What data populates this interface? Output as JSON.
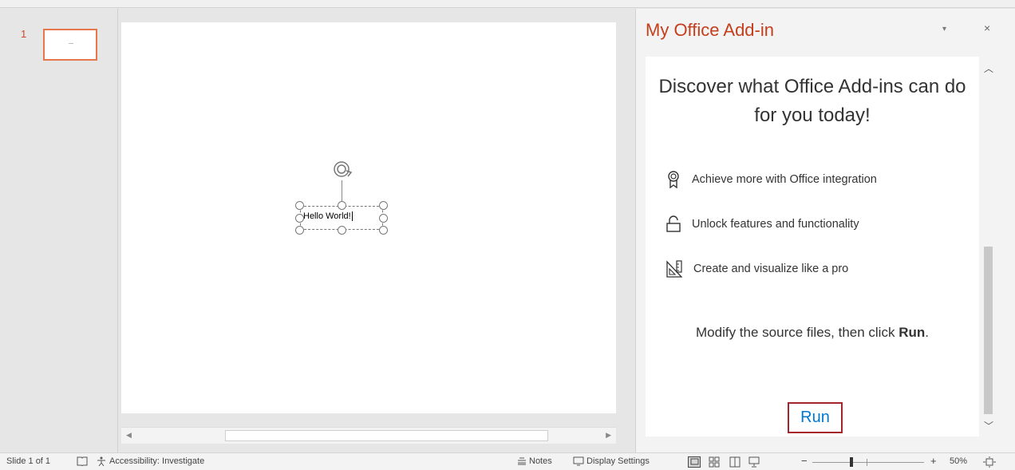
{
  "thumbnail": {
    "number": "1"
  },
  "slide": {
    "textbox_text": "Hello World!"
  },
  "task_pane": {
    "title": "My Office Add-in",
    "minimize_glyph": "▾",
    "close_glyph": "×",
    "heading": "Discover what Office Add-ins can do for you today!",
    "features": [
      {
        "icon": "ribbon-icon",
        "label": "Achieve more with Office integration"
      },
      {
        "icon": "unlock-icon",
        "label": "Unlock features and functionality"
      },
      {
        "icon": "design-ideas-icon",
        "label": "Create and visualize like a pro"
      }
    ],
    "modify_prefix": "Modify the source files, then click ",
    "modify_bold": "Run",
    "modify_suffix": ".",
    "run_label": "Run"
  },
  "status_bar": {
    "slide_count": "Slide 1 of 1",
    "accessibility": "Accessibility: Investigate",
    "notes": "Notes",
    "display_settings": "Display Settings",
    "zoom_level": "50%",
    "zoom_minus": "−",
    "zoom_plus": "+"
  },
  "colors": {
    "title_accent": "#c43e1c",
    "run_text": "#0078d4",
    "run_border": "#a4262c",
    "thumb_border": "#e8764f"
  }
}
